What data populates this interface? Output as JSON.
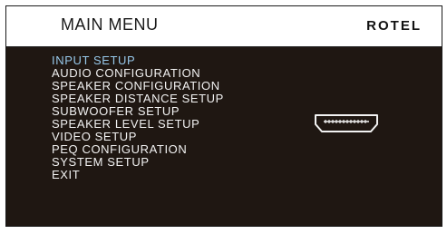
{
  "header": {
    "title": "MAIN  MENU",
    "brand": "ROTEL"
  },
  "menu": {
    "selected_index": 0,
    "items": [
      {
        "label": "INPUT  SETUP"
      },
      {
        "label": "AUDIO  CONFIGURATION"
      },
      {
        "label": "SPEAKER  CONFIGURATION"
      },
      {
        "label": "SPEAKER  DISTANCE  SETUP"
      },
      {
        "label": "SUBWOOFER  SETUP"
      },
      {
        "label": "SPEAKER  LEVEL  SETUP"
      },
      {
        "label": "VIDEO  SETUP"
      },
      {
        "label": "PEQ CONFIGURATION"
      },
      {
        "label": "SYSTEM  SETUP"
      },
      {
        "label": "EXIT"
      }
    ]
  },
  "icons": {
    "connector": "hdmi-connector-icon"
  },
  "colors": {
    "background": "#1f1712",
    "text": "#f2f2f2",
    "selected_text": "#97c8ea",
    "header_background": "#ffffff"
  }
}
